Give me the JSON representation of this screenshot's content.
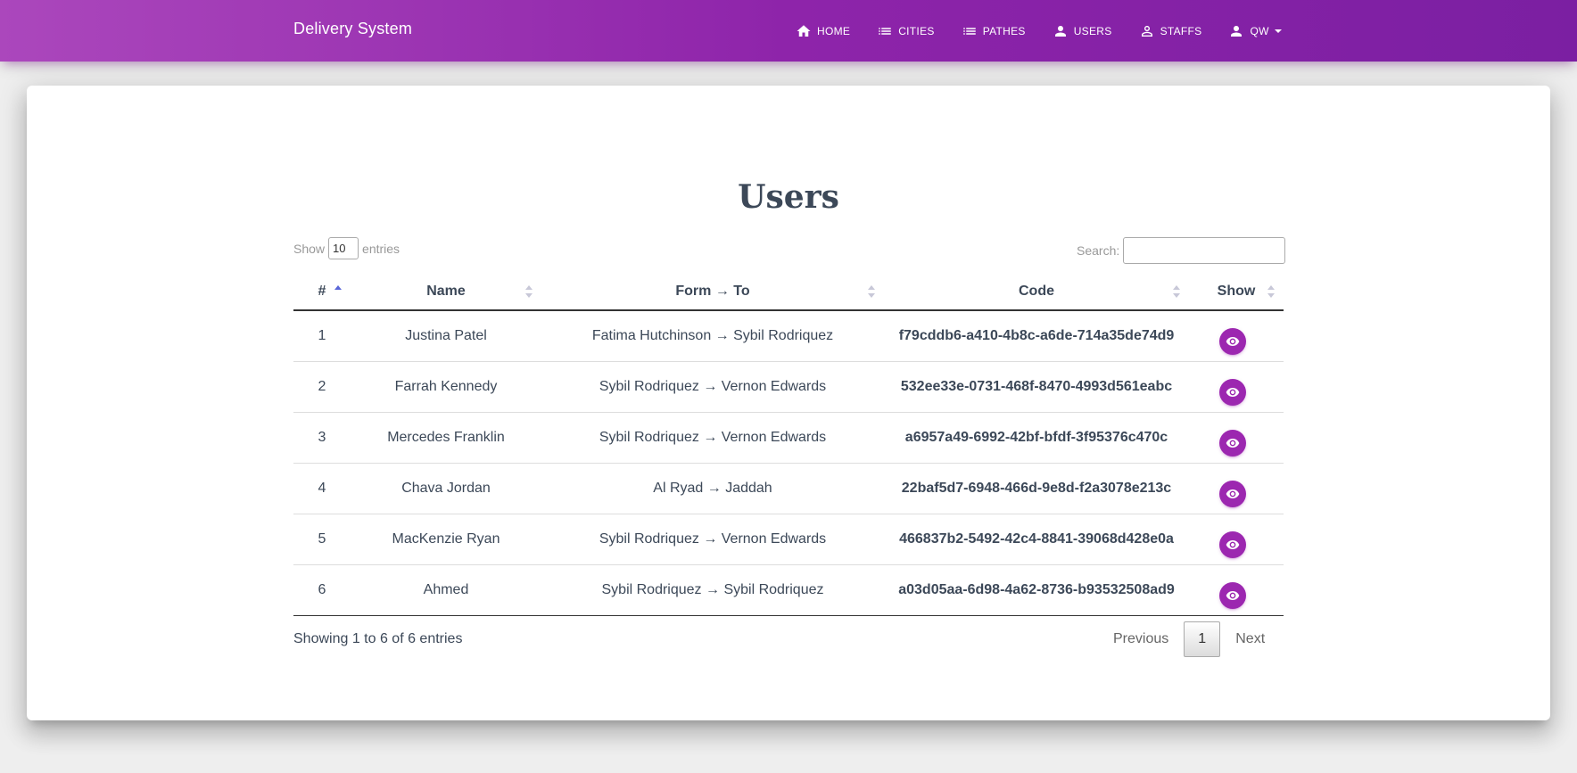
{
  "nav": {
    "brand": "Delivery System",
    "items": [
      {
        "label": "HOME",
        "icon": "home-icon"
      },
      {
        "label": "CITIES",
        "icon": "list-icon"
      },
      {
        "label": "PATHES",
        "icon": "list-icon"
      },
      {
        "label": "USERS",
        "icon": "person-icon"
      },
      {
        "label": "STAFFS",
        "icon": "person-outline-icon"
      },
      {
        "label": "QW",
        "icon": "person-icon"
      }
    ]
  },
  "page": {
    "title": "Users"
  },
  "length_control": {
    "prefix": "Show",
    "value": "10",
    "suffix": "entries"
  },
  "search": {
    "label": "Search:",
    "value": ""
  },
  "table": {
    "headers": [
      "#",
      "Name",
      "Form → To",
      "Code",
      "Show"
    ],
    "rows": [
      {
        "num": "1",
        "name": "Justina Patel",
        "route": "Fatima Hutchinson → Sybil Rodriquez",
        "code": "f79cddb6-a410-4b8c-a6de-714a35de74d9"
      },
      {
        "num": "2",
        "name": "Farrah Kennedy",
        "route": "Sybil Rodriquez → Vernon Edwards",
        "code": "532ee33e-0731-468f-8470-4993d561eabc"
      },
      {
        "num": "3",
        "name": "Mercedes Franklin",
        "route": "Sybil Rodriquez → Vernon Edwards",
        "code": "a6957a49-6992-42bf-bfdf-3f95376c470c"
      },
      {
        "num": "4",
        "name": "Chava Jordan",
        "route": "Al Ryad → Jaddah",
        "code": "22baf5d7-6948-466d-9e8d-f2a3078e213c"
      },
      {
        "num": "5",
        "name": "MacKenzie Ryan",
        "route": "Sybil Rodriquez → Vernon Edwards",
        "code": "466837b2-5492-42c4-8841-39068d428e0a"
      },
      {
        "num": "6",
        "name": "Ahmed",
        "route": "Sybil Rodriquez → Sybil Rodriquez",
        "code": "a03d05aa-6d98-4a62-8736-b93532508ad9"
      }
    ]
  },
  "footer": {
    "info": "Showing 1 to 6 of 6 entries",
    "previous": "Previous",
    "page": "1",
    "next": "Next"
  },
  "colors": {
    "accent": "#9c27b0",
    "nav_gradient_start": "#ab47bc",
    "nav_gradient_end": "#7b1fa2"
  }
}
